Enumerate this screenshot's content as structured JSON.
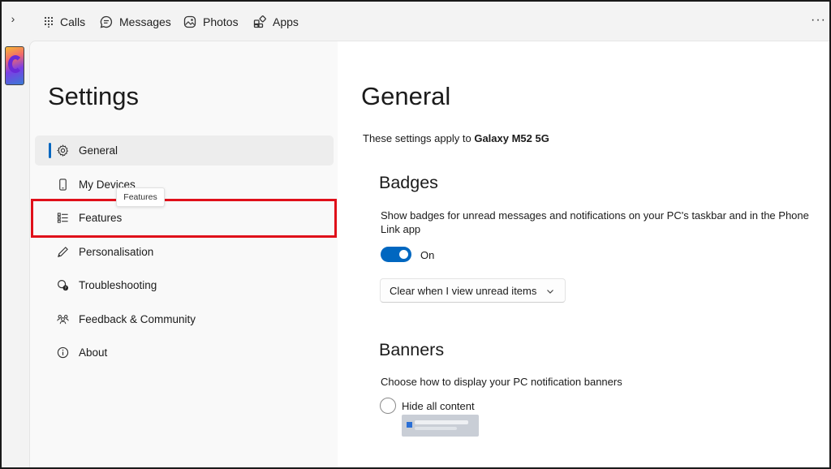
{
  "topnav": {
    "items": [
      {
        "label": "Calls",
        "icon": "dialpad-icon"
      },
      {
        "label": "Messages",
        "icon": "chat-icon"
      },
      {
        "label": "Photos",
        "icon": "photos-icon"
      },
      {
        "label": "Apps",
        "icon": "apps-icon"
      }
    ],
    "more": "···",
    "expand": "›"
  },
  "sidebar": {
    "title": "Settings",
    "items": [
      {
        "label": "General",
        "icon": "gear-icon",
        "selected": true
      },
      {
        "label": "My Devices",
        "icon": "phone-icon"
      },
      {
        "label": "Features",
        "icon": "list-icon",
        "highlighted": true
      },
      {
        "label": "Personalisation",
        "icon": "pen-icon"
      },
      {
        "label": "Troubleshooting",
        "icon": "troubleshoot-icon"
      },
      {
        "label": "Feedback & Community",
        "icon": "people-icon"
      },
      {
        "label": "About",
        "icon": "info-icon"
      }
    ],
    "tooltip": "Features"
  },
  "main": {
    "title": "General",
    "applies_prefix": "These settings apply to",
    "device_name": "Galaxy M52 5G",
    "badges": {
      "title": "Badges",
      "description": "Show badges for unread messages and notifications on your PC's taskbar and in the Phone Link app",
      "toggle_label": "On",
      "toggle_on": true,
      "dropdown_value": "Clear when I view unread items"
    },
    "banners": {
      "title": "Banners",
      "description": "Choose how to display your PC notification banners",
      "option_hide": "Hide all content"
    }
  },
  "colors": {
    "accent": "#0067c0",
    "highlight_box": "#e0101a"
  }
}
